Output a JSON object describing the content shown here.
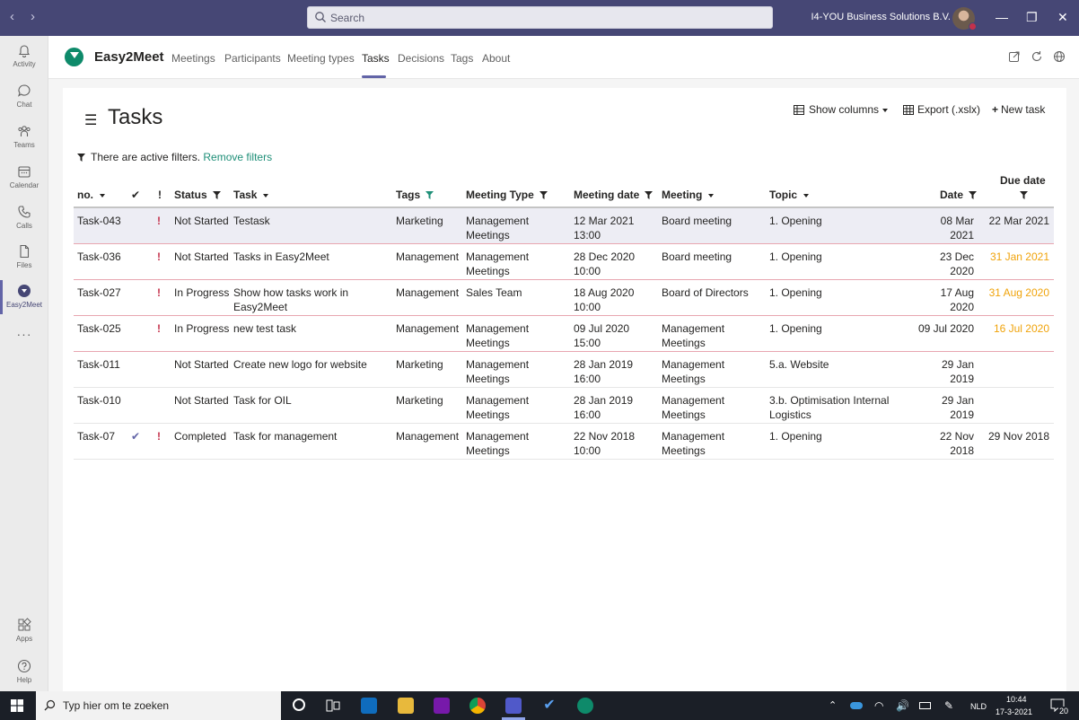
{
  "titlebar": {
    "search_placeholder": "Search",
    "org_name": "I4-YOU Business Solutions B.V.",
    "back_icon": "chevron-left-icon",
    "forward_icon": "chevron-right-icon"
  },
  "rail": {
    "items": [
      {
        "label": "Activity",
        "icon": "bell-icon"
      },
      {
        "label": "Chat",
        "icon": "chat-icon"
      },
      {
        "label": "Teams",
        "icon": "teams-icon"
      },
      {
        "label": "Calendar",
        "icon": "calendar-icon"
      },
      {
        "label": "Calls",
        "icon": "phone-icon"
      },
      {
        "label": "Files",
        "icon": "file-icon"
      },
      {
        "label": "Easy2Meet",
        "icon": "easy2meet-icon"
      },
      {
        "label": "Apps",
        "icon": "apps-icon"
      },
      {
        "label": "Help",
        "icon": "help-icon"
      }
    ]
  },
  "app": {
    "name": "Easy2Meet",
    "tabs": [
      "Meetings",
      "Participants",
      "Meeting types",
      "Tasks",
      "Decisions",
      "Tags",
      "About"
    ],
    "active_tab": "Tasks"
  },
  "page": {
    "title": "Tasks",
    "show_columns": "Show columns",
    "export": "Export (.xslx)",
    "new_task": "New task",
    "filter_notice": "There are active filters.",
    "remove_filters": "Remove filters",
    "accent_color": "#1f8f78",
    "brand_color": "#6264a7",
    "priority_color": "#c4314b",
    "overdue_color": "#f0a30a"
  },
  "table": {
    "headers": {
      "no": "no.",
      "done": "✔",
      "prio": "!",
      "status": "Status",
      "task": "Task",
      "tags": "Tags",
      "meeting_type": "Meeting Type",
      "meeting_date": "Meeting date",
      "meeting": "Meeting",
      "topic": "Topic",
      "date": "Date",
      "due_date": "Due date"
    },
    "rows": [
      {
        "no": "Task-043",
        "done": "",
        "prio": "!",
        "status": "Not Started",
        "task": "Testask",
        "tags": "Marketing",
        "meeting_type": "Management Meetings",
        "meeting_date": "12 Mar 2021 13:00",
        "meeting": "Board meeting",
        "topic": "1. Opening",
        "date": "08 Mar 2021",
        "due_date": "22 Mar 2021",
        "due_overdue": false
      },
      {
        "no": "Task-036",
        "done": "",
        "prio": "!",
        "status": "Not Started",
        "task": "Tasks in Easy2Meet",
        "tags": "Management",
        "meeting_type": "Management Meetings",
        "meeting_date": "28 Dec 2020 10:00",
        "meeting": "Board meeting",
        "topic": "1. Opening",
        "date": "23 Dec 2020",
        "due_date": "31 Jan 2021",
        "due_overdue": true
      },
      {
        "no": "Task-027",
        "done": "",
        "prio": "!",
        "status": "In Progress",
        "task": "Show how tasks work in Easy2Meet",
        "tags": "Management",
        "meeting_type": "Sales Team",
        "meeting_date": "18 Aug 2020 10:00",
        "meeting": "Board of Directors",
        "topic": "1. Opening",
        "date": "17 Aug 2020",
        "due_date": "31 Aug 2020",
        "due_overdue": true
      },
      {
        "no": "Task-025",
        "done": "",
        "prio": "!",
        "status": "In Progress",
        "task": "new test task",
        "tags": "Management",
        "meeting_type": "Management Meetings",
        "meeting_date": "09 Jul 2020 15:00",
        "meeting": "Management Meetings",
        "topic": "1. Opening",
        "date": "09 Jul 2020",
        "due_date": "16 Jul 2020",
        "due_overdue": true
      },
      {
        "no": "Task-011",
        "done": "",
        "prio": "",
        "status": "Not Started",
        "task": "Create new logo for website",
        "tags": "Marketing",
        "meeting_type": "Management Meetings",
        "meeting_date": "28 Jan 2019 16:00",
        "meeting": "Management Meetings",
        "topic": "5.a. Website",
        "date": "29 Jan 2019",
        "due_date": "",
        "due_overdue": false
      },
      {
        "no": "Task-010",
        "done": "",
        "prio": "",
        "status": "Not Started",
        "task": "Task for OIL",
        "tags": "Marketing",
        "meeting_type": "Management Meetings",
        "meeting_date": "28 Jan 2019 16:00",
        "meeting": "Management Meetings",
        "topic": "3.b. Optimisation Internal Logistics",
        "date": "29 Jan 2019",
        "due_date": "",
        "due_overdue": false
      },
      {
        "no": "Task-07",
        "done": "✔",
        "prio": "!",
        "status": "Completed",
        "task": "Task for management",
        "tags": "Management",
        "meeting_type": "Management Meetings",
        "meeting_date": "22 Nov 2018 10:00",
        "meeting": "Management Meetings",
        "topic": "1. Opening",
        "date": "22 Nov 2018",
        "due_date": "29 Nov 2018",
        "due_overdue": false
      }
    ]
  },
  "taskbar": {
    "search_placeholder": "Typ hier om te zoeken",
    "language": "NLD",
    "time": "10:44",
    "date": "17-3-2021",
    "notifications": "20"
  }
}
